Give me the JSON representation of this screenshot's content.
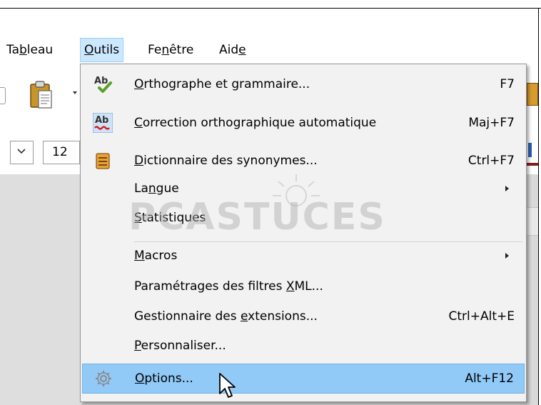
{
  "menubar": {
    "items": [
      {
        "label": "Tableau",
        "pre": "Ta",
        "u": "b",
        "post": "leau"
      },
      {
        "label": "Outils",
        "pre": "",
        "u": "O",
        "post": "utils"
      },
      {
        "label": "Fenêtre",
        "pre": "Fe",
        "u": "n",
        "post": "être"
      },
      {
        "label": "Aide",
        "pre": "Aid",
        "u": "e",
        "post": ""
      }
    ]
  },
  "toolbar": {
    "font_size": "12"
  },
  "menu": {
    "items": [
      {
        "label": "Orthographe et grammaire...",
        "pre": "",
        "u": "O",
        "post": "rthographe et grammaire...",
        "shortcut": "F7",
        "icon": "spellcheck-icon"
      },
      {
        "label": "Correction orthographique automatique",
        "pre": "",
        "u": "C",
        "post": "orrection orthographique automatique",
        "shortcut": "Maj+F7",
        "icon": "autocorrect-icon"
      },
      {
        "label": "Dictionnaire des synonymes...",
        "pre": "",
        "u": "D",
        "post": "ictionnaire des synonymes...",
        "shortcut": "Ctrl+F7",
        "icon": "thesaurus-icon"
      },
      {
        "label": "Langue",
        "pre": "La",
        "u": "n",
        "post": "gue",
        "shortcut": "",
        "submenu": true
      },
      {
        "label": "Statistiques",
        "pre": "",
        "u": "S",
        "post": "tatistiques",
        "shortcut": ""
      },
      {
        "label": "Macros",
        "pre": "",
        "u": "M",
        "post": "acros",
        "shortcut": "",
        "submenu": true
      },
      {
        "label": "Paramétrages des filtres XML...",
        "pre": "Paramétrages des filtres ",
        "u": "X",
        "post": "ML...",
        "shortcut": ""
      },
      {
        "label": "Gestionnaire des extensions...",
        "pre": "Gestionnaire des ",
        "u": "e",
        "post": "xtensions...",
        "shortcut": "Ctrl+Alt+E"
      },
      {
        "label": "Personnaliser...",
        "pre": "",
        "u": "P",
        "post": "ersonnaliser...",
        "shortcut": ""
      },
      {
        "label": "Options...",
        "pre": "",
        "u": "O",
        "post": "ptions...",
        "shortcut": "Alt+F12",
        "icon": "gear-icon",
        "highlighted": true
      }
    ]
  },
  "watermark": {
    "text": "PCASTUCES"
  },
  "colors": {
    "menu_bg": "#f2f2f2",
    "highlight": "#91c9f7",
    "active_menubar": "#cce8ff",
    "doc_bg": "#d9d9d9"
  }
}
